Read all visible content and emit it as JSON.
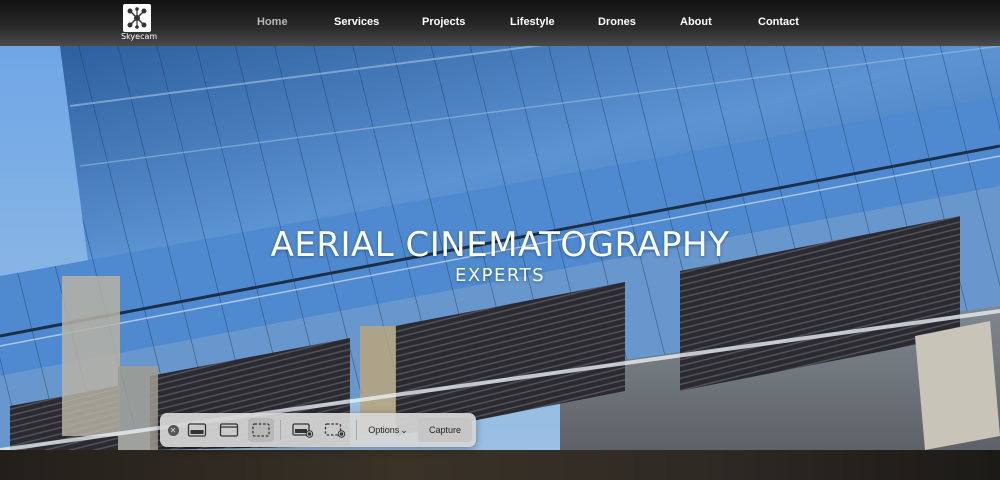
{
  "header": {
    "logo_text": "Skyecam",
    "nav": [
      {
        "label": "Home",
        "active": true
      },
      {
        "label": "Services",
        "active": false
      },
      {
        "label": "Projects",
        "active": false
      },
      {
        "label": "Lifestyle",
        "active": false
      },
      {
        "label": "Drones",
        "active": false
      },
      {
        "label": "About",
        "active": false
      },
      {
        "label": "Contact",
        "active": false
      }
    ]
  },
  "hero": {
    "title": "AERIAL CINEMATOGRAPHY",
    "subtitle": "EXPERTS"
  },
  "capture_toolbar": {
    "close_icon": "close-icon",
    "modes": [
      {
        "name": "capture-entire-screen-icon",
        "selected": false
      },
      {
        "name": "capture-selected-window-icon",
        "selected": false
      },
      {
        "name": "capture-selected-portion-icon",
        "selected": true
      },
      {
        "name": "record-entire-screen-icon",
        "selected": false
      },
      {
        "name": "record-selected-portion-icon",
        "selected": false
      }
    ],
    "options_label": "Options",
    "options_chevron": "⌄",
    "capture_label": "Capture"
  },
  "colors": {
    "nav_active": "#b7b7b7",
    "nav_text": "#ffffff",
    "sky": "#4c8fd8",
    "toolbar_bg": "#d6d6d6"
  }
}
